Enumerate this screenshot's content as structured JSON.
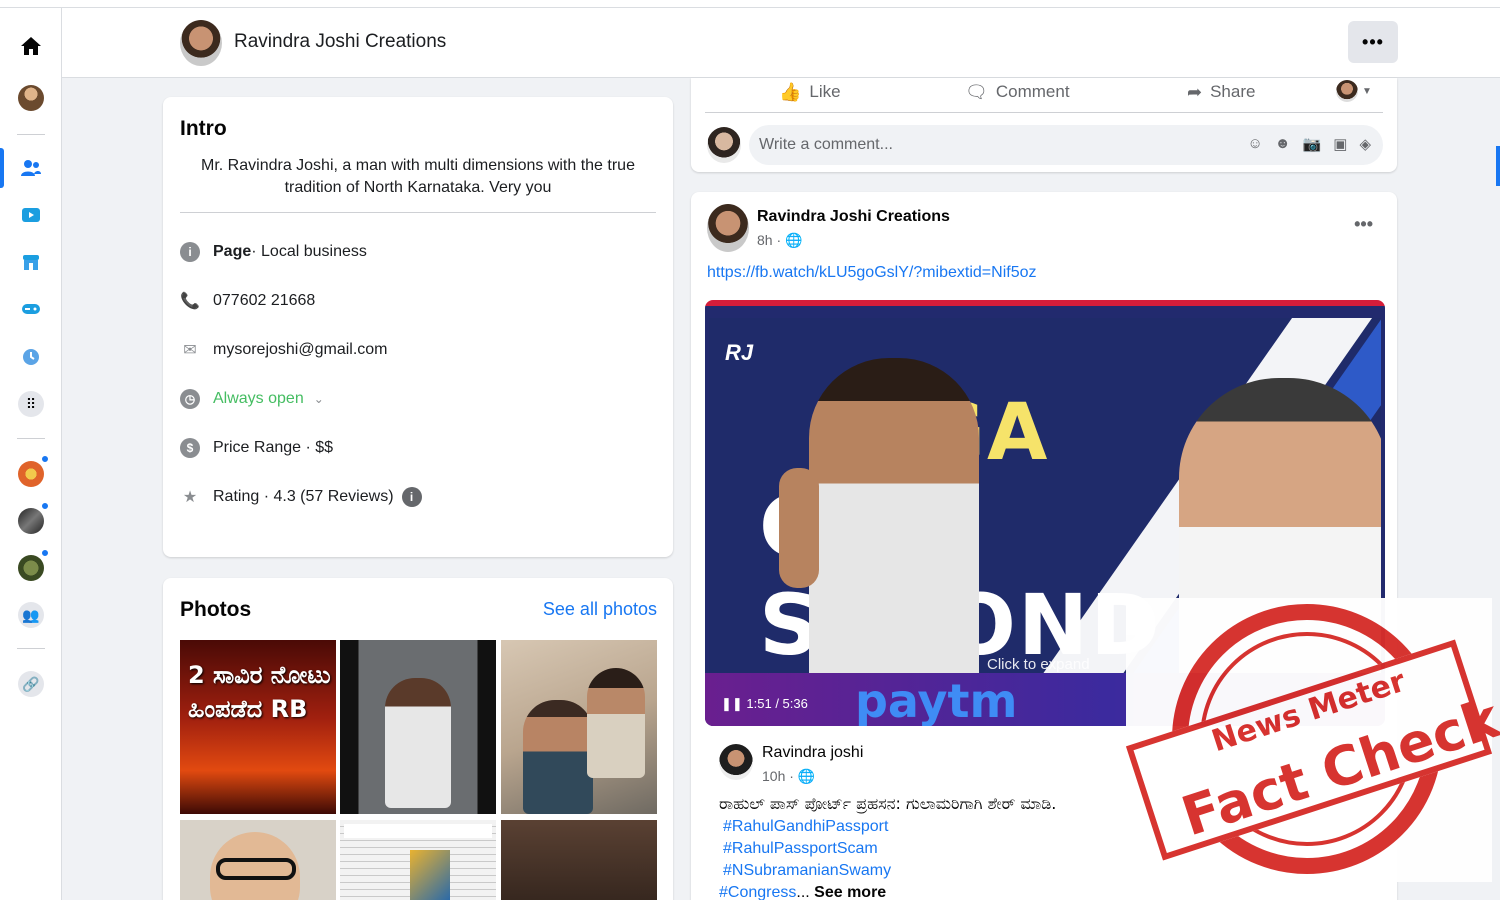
{
  "page": {
    "title": "Ravindra Joshi Creations",
    "more_label": "•••"
  },
  "intro": {
    "heading": "Intro",
    "bio": "Mr. Ravindra Joshi, a man with multi dimensions with the true tradition of North Karnataka. Very you",
    "rows": {
      "page_bold": "Page",
      "page_category": " · Local business",
      "phone": "077602 21668",
      "email": "mysorejoshi@gmail.com",
      "hours": "Always open",
      "price": "Price Range · $$",
      "rating": "Rating · 4.3 (57 Reviews)"
    }
  },
  "photos": {
    "heading": "Photos",
    "see_all": "See all photos",
    "photo1_text": "2 ಸಾವಿರ ನೋಟು ಹಿಂಪಡೆದ RB"
  },
  "actions": {
    "like": "Like",
    "comment": "Comment",
    "share": "Share",
    "comment_placeholder": "Write a comment..."
  },
  "post": {
    "author": "Ravindra Joshi Creations",
    "time": "8h · ",
    "link": "https://fb.watch/kLU5goGslY/?mibextid=Nif5oz",
    "video": {
      "overlay_line1": "GA",
      "overlay_line2": "GET SECOND",
      "brand": "paytm",
      "time": "1:51 / 5:36",
      "expand": "Click to expand",
      "logo": "RJ"
    },
    "shared": {
      "author": "Ravindra joshi",
      "time": "10h · ",
      "text": "ರಾಹುಲ್ ಪಾಸ್ ಪೋರ್ಟ್ ಪ್ರಹಸನ: ಗುಲಾಮರಿಗಾಗಿ ಶೇರ್ ಮಾಡಿ.",
      "tags": [
        "#RahulGandhiPassport",
        "#RahulPassportScam",
        "#NSubramanianSwamy"
      ],
      "last_tag": "#Congress",
      "ellipsis": "... ",
      "see_more": "See more"
    }
  },
  "watermark": {
    "brand": "News Meter",
    "label": "Fact Check"
  },
  "colors": {
    "accent": "#1877f2",
    "stamp_red": "#d62e2a",
    "open_green": "#45bd62"
  }
}
